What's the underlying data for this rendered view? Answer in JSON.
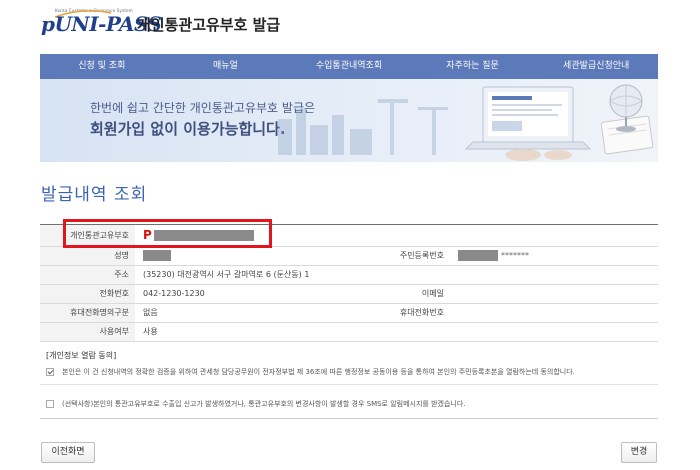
{
  "header": {
    "logo_tagline": "Korea Customs e-Clearance System",
    "logo_text": "UNI-PASS",
    "logo_prefix": "p",
    "site_title": "개인통관고유부호 발급"
  },
  "nav": {
    "items": [
      "신청 및 조회",
      "매뉴얼",
      "수입통관내역조회",
      "자주하는 질문",
      "세관발급신청안내"
    ]
  },
  "banner": {
    "line1": "한번에 쉽고 간단한 개인통관고유부호 발급은",
    "line2": "회원가입 없이 이용가능합니다."
  },
  "page_title": "발급내역 조회",
  "table": {
    "code_label": "개인통관고유부호",
    "code_prefix": "P",
    "name_label": "성명",
    "rrn_label": "주민등록번호",
    "rrn_suffix": "*******",
    "address_label": "주소",
    "address_value": "(35230) 대전광역시 서구 갈마역로 6 (둔산동) 1",
    "phone_label": "전화번호",
    "phone_value": "042-1230-1230",
    "email_label": "이메일",
    "mobile_type_label": "휴대전화명의구분",
    "mobile_type_value": "없음",
    "mobile_label": "휴대전화번호",
    "usage_label": "사용여부",
    "usage_value": "사용"
  },
  "consent": {
    "title": "[개인정보 열람 동의]",
    "item1": "본인은 이 건 신청내역의 정확한 검증을 위하여 관세청 담당공무원이 전자정부법 제 36조에 따른 행정정보 공동이용 등을 통하여 본인의 주민등록초본을 열람하는데 동의합니다.",
    "item2": "(선택사항)본인의 통관고유부호로 수출입 신고가 발생하였거나, 통관고유부호의 변경사항이 발생할 경우 SMS로 알림메시지를 받겠습니다.",
    "item1_checked": true,
    "item2_checked": false
  },
  "buttons": {
    "prev": "이전화면",
    "change": "변경"
  },
  "colors": {
    "nav_bg": "#5c79b9",
    "title_blue": "#3b63b5",
    "highlight_red": "#e2141d"
  }
}
